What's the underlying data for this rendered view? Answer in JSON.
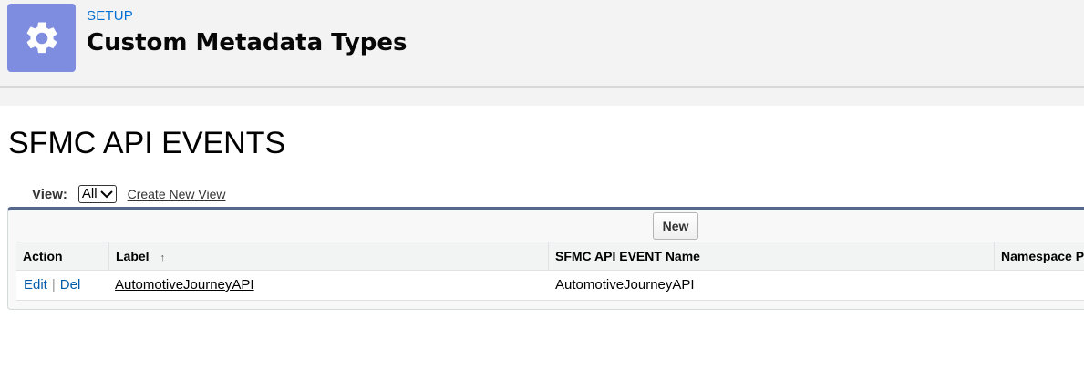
{
  "header": {
    "setup_label": "SETUP",
    "title": "Custom Metadata Types",
    "icon": "gear-icon",
    "icon_bg": "#7f8de1"
  },
  "list": {
    "title": "SFMC API EVENTS",
    "view_label": "View:",
    "view_selected": "All",
    "create_view_link": "Create New View",
    "new_button": "New"
  },
  "table": {
    "columns": [
      "Action",
      "Label",
      "SFMC API EVENT Name",
      "Namespace Prefix"
    ],
    "sort_indicator": "↑",
    "rows": [
      {
        "edit": "Edit",
        "separator": "|",
        "del": "Del",
        "label": "AutomotiveJourneyAPI",
        "name": "AutomotiveJourneyAPI",
        "namespace": ""
      }
    ]
  },
  "colors": {
    "link": "#015ba7",
    "setup_label": "#0070d2",
    "panel_border": "#56678c"
  }
}
